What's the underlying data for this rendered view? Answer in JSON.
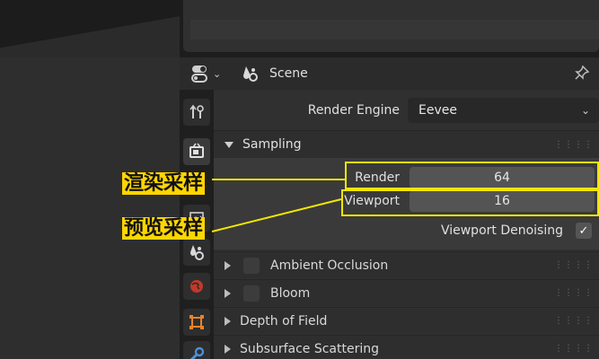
{
  "header": {
    "context": "Scene"
  },
  "panel": {
    "render_engine_label": "Render Engine",
    "render_engine_value": "Eevee",
    "sampling": {
      "title": "Sampling",
      "render_label": "Render",
      "render_value": "64",
      "viewport_label": "Viewport",
      "viewport_value": "16",
      "denoise_label": "Viewport Denoising",
      "denoise_checked": true
    },
    "sections": [
      {
        "label": "Ambient Occlusion",
        "has_checkbox": true
      },
      {
        "label": "Bloom",
        "has_checkbox": true
      },
      {
        "label": "Depth of Field",
        "has_checkbox": false
      },
      {
        "label": "Subsurface Scattering",
        "has_checkbox": false
      }
    ]
  },
  "annotations": {
    "render_samples": "渲染采样",
    "viewport_samples": "预览采样"
  },
  "colors": {
    "annotation": "#f2e600",
    "field_bg": "#545454",
    "panel_bg": "#303030"
  }
}
